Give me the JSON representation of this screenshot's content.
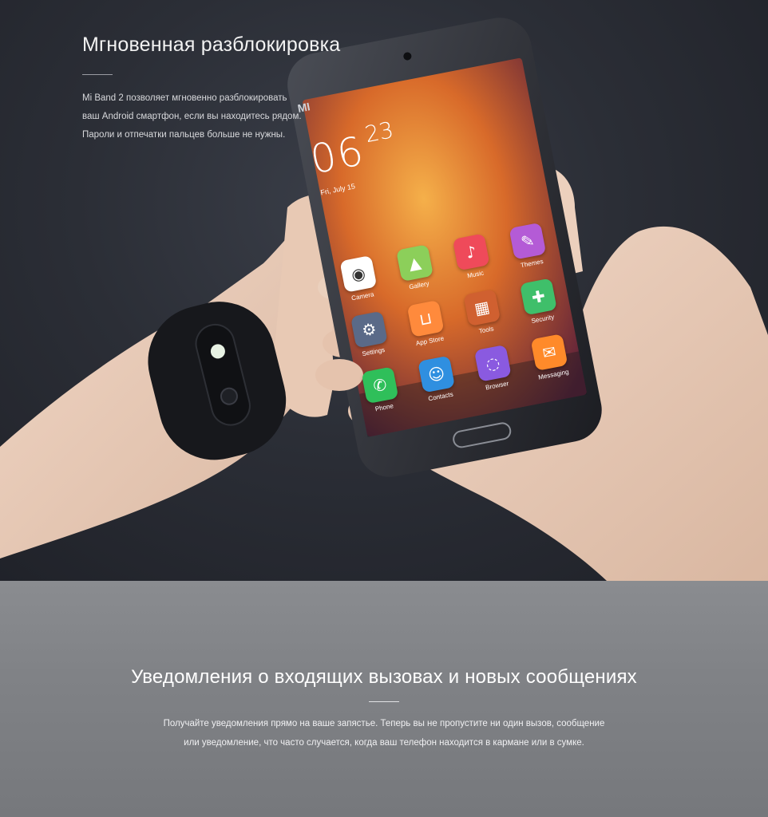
{
  "unlock": {
    "title": "Мгновенная разблокировка",
    "lines": [
      "Mi Band 2 позволяет мгновенно разблокировать",
      "ваш Android смартфон, если вы находитесь рядом.",
      "Пароли и отпечатки пальцев больше не нужны."
    ]
  },
  "phone": {
    "brand": "MI",
    "time_hours": "06",
    "time_minutes": "23",
    "date": "Fri, July 15",
    "apps": [
      {
        "label": "Camera",
        "color": "#ffffff",
        "icon": "camera-icon"
      },
      {
        "label": "Gallery",
        "color": "#8ccf5a",
        "icon": "gallery-icon"
      },
      {
        "label": "Music",
        "color": "#ef4a5a",
        "icon": "music-icon"
      },
      {
        "label": "Themes",
        "color": "#b45bd6",
        "icon": "themes-icon"
      },
      {
        "label": "Settings",
        "color": "#5a6a88",
        "icon": "settings-icon"
      },
      {
        "label": "App Store",
        "color": "#ff8a3c",
        "icon": "app-store-icon"
      },
      {
        "label": "Tools",
        "color": "#d06030",
        "icon": "tools-icon"
      },
      {
        "label": "Security",
        "color": "#3fbf6a",
        "icon": "security-icon"
      },
      {
        "label": "Phone",
        "color": "#2fbf5a",
        "icon": "phone-icon"
      },
      {
        "label": "Contacts",
        "color": "#2f8fe0",
        "icon": "contacts-icon"
      },
      {
        "label": "Browser",
        "color": "#8a5ae0",
        "icon": "browser-icon"
      },
      {
        "label": "Messaging",
        "color": "#ff8a2a",
        "icon": "messaging-icon"
      }
    ]
  },
  "notifications": {
    "title": "Уведомления о входящих вызовах и новых сообщениях",
    "line1": "Получайте уведомления прямо на ваше запястье. Теперь вы не пропустите ни один вызов, сообщение",
    "line2": "или уведомление, что часто случается, когда ваш телефон находится в кармане или в сумке."
  }
}
